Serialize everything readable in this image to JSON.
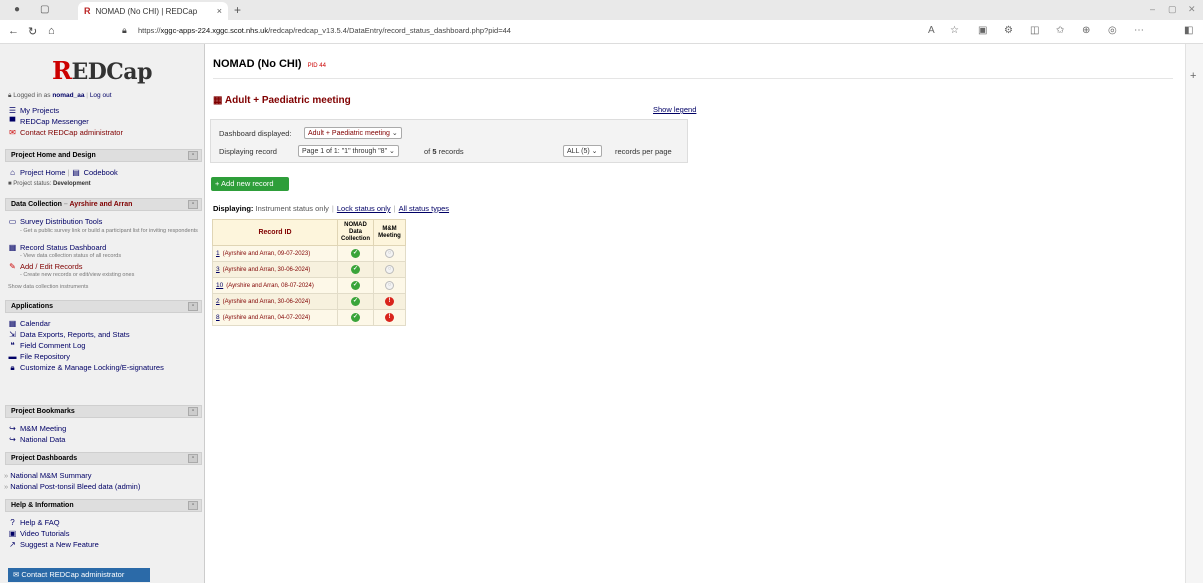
{
  "browser": {
    "tab_title": "NOMAD (No CHI) | REDCap",
    "new_tab": "+",
    "close_tab": "×",
    "url_prefix": "https://",
    "url_host": "xggc-apps-224.xggc.scot.nhs.uk",
    "url_path": "/redcap/redcap_v13.5.4/DataEntry/record_status_dashboard.php?pid=44"
  },
  "sidebar": {
    "logo_r": "R",
    "logo_rest": "EDCap",
    "logged_in_prefix": "Logged in as",
    "username": "nomad_aa",
    "logout": "Log out",
    "top_links": [
      "My Projects",
      "REDCap Messenger",
      "Contact REDCap administrator"
    ],
    "sections": {
      "home_design": "Project Home and Design",
      "data_collection": "Data Collection",
      "data_collection_dag": "Ayrshire and Arran",
      "applications": "Applications",
      "bookmarks": "Project Bookmarks",
      "dashboards": "Project Dashboards",
      "help": "Help & Information"
    },
    "project_home": "Project Home",
    "codebook": "Codebook",
    "project_status_label": "Project status:",
    "project_status_value": "Development",
    "survey_tools": "Survey Distribution Tools",
    "survey_tools_desc": "- Get a public survey link or build a participant list for inviting respondents",
    "record_status": "Record Status Dashboard",
    "record_status_desc": "- View data collection status of all records",
    "add_edit": "Add / Edit Records",
    "add_edit_desc": "- Create new records or edit/view existing ones",
    "show_instruments": "Show data collection instruments",
    "apps": [
      "Calendar",
      "Data Exports, Reports, and Stats",
      "Field Comment Log",
      "File Repository",
      "Customize & Manage Locking/E-signatures"
    ],
    "bookmarks_list": [
      "M&M Meeting",
      "National Data"
    ],
    "dashboards_list": [
      "National M&M Summary",
      "National Post-tonsil Bleed data (admin)"
    ],
    "help_list": [
      "Help & FAQ",
      "Video Tutorials",
      "Suggest a New Feature"
    ],
    "contact_button": "Contact REDCap administrator"
  },
  "main": {
    "project_title": "NOMAD (No CHI)",
    "pid": "PID 44",
    "dashboard_title": "Adult + Paediatric meeting",
    "show_legend": "Show legend",
    "dashboard_displayed_label": "Dashboard displayed:",
    "dashboard_selected": "Adult + Paediatric meeting",
    "displaying_record_label": "Displaying record",
    "page_selected": "Page 1 of 1: \"1\" through \"8\"",
    "of_records_prefix": "of",
    "records_count": "5",
    "of_records_suffix": "records",
    "per_page_selected": "ALL (5)",
    "records_per_page": "records per page",
    "add_new_record": "+ Add new record",
    "displaying_label": "Displaying:",
    "display_opt1": "Instrument status only",
    "display_opt2": "Lock status only",
    "display_opt3": "All status types",
    "table": {
      "col_record_id": "Record ID",
      "col_nomad": "NOMAD Data Collection",
      "col_mm": "M&M Meeting",
      "rows": [
        {
          "id": "1",
          "info": "(Ayrshire and Arran, 09-07-2023)",
          "nomad": "green",
          "mm": "grey"
        },
        {
          "id": "3",
          "info": "(Ayrshire and Arran, 30-06-2024)",
          "nomad": "green",
          "mm": "grey"
        },
        {
          "id": "10",
          "info": "(Ayrshire and Arran, 08-07-2024)",
          "nomad": "green",
          "mm": "grey"
        },
        {
          "id": "2",
          "info": "(Ayrshire and Arran, 30-06-2024)",
          "nomad": "green",
          "mm": "red"
        },
        {
          "id": "8",
          "info": "(Ayrshire and Arran, 04-07-2024)",
          "nomad": "green",
          "mm": "red"
        }
      ]
    }
  },
  "colors": {
    "brand_red": "#c00000",
    "dark_red": "#800000",
    "link": "#000066",
    "green": "#2e9e3a"
  }
}
